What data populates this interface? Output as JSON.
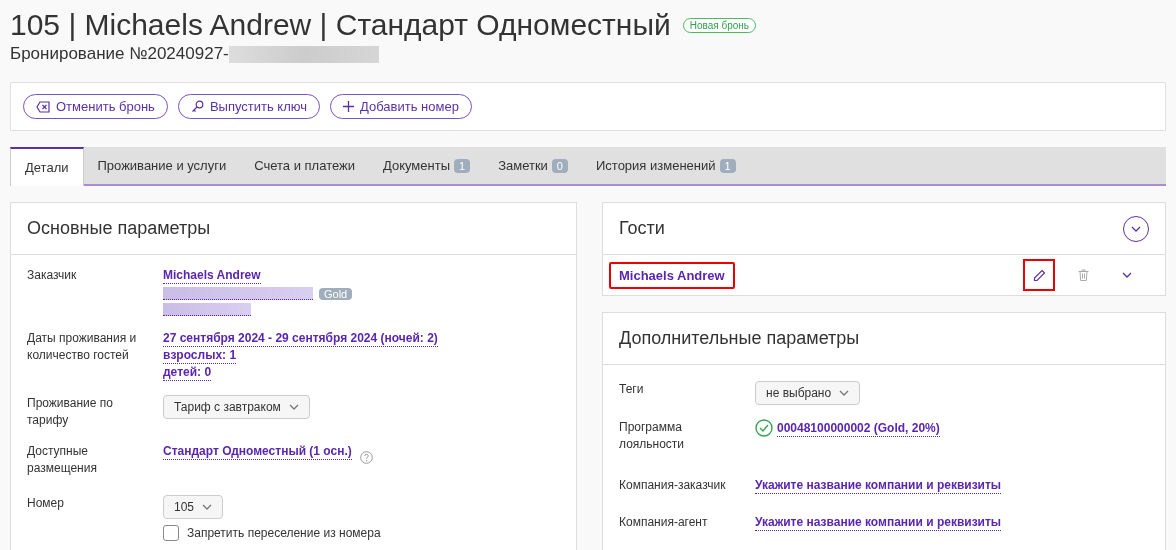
{
  "header": {
    "title": "105 | Michaels Andrew | Стандарт Одноместный",
    "status_badge": "Новая бронь",
    "subtitle": "Бронирование №20240927-",
    "subtitle_redacted": true
  },
  "actions": [
    {
      "label": "Отменить бронь",
      "kind": "cancel"
    },
    {
      "label": "Выпустить ключ",
      "kind": "key"
    },
    {
      "label": "Добавить номер",
      "kind": "add"
    }
  ],
  "tabs": [
    {
      "label": "Детали",
      "selected": true
    },
    {
      "label": "Проживание и услуги",
      "selected": false
    },
    {
      "label": "Счета и платежи",
      "selected": false
    },
    {
      "label": "Документы",
      "count": "1",
      "selected": false
    },
    {
      "label": "Заметки",
      "count": "0",
      "selected": false
    },
    {
      "label": "История изменений",
      "count": "1",
      "selected": false
    }
  ],
  "main_params": {
    "title": "Основные параметры",
    "rows": [
      {
        "kind": "customer",
        "label": "Заказчик",
        "name": "Michaels Andrew",
        "badge": "Gold",
        "redacted": true
      },
      {
        "kind": "links",
        "label": "Даты проживания и количество гостей",
        "links": [
          "27 сентября 2024 - 29 сентября 2024 (ночей: 2)",
          "взрослых: 1",
          "детей: 0"
        ]
      },
      {
        "kind": "select",
        "label": "Проживание по тарифу",
        "value": "Тариф с завтраком"
      },
      {
        "kind": "help_link",
        "label": "Доступные размещения",
        "value": "Стандарт Одноместный (1 осн.)"
      },
      {
        "kind": "select",
        "label": "Номер",
        "value": "105",
        "checkbox": {
          "label": "Запретить переселение из номера",
          "checked": false
        }
      }
    ]
  },
  "guests": {
    "title": "Гости",
    "items": [
      {
        "name": "Michaels Andrew",
        "highlighted": true,
        "edit_highlighted": true
      }
    ]
  },
  "extra_params": {
    "title": "Дополнительные параметры",
    "rows": [
      {
        "kind": "select",
        "label": "Теги",
        "value": "не выбрано"
      },
      {
        "kind": "loyalty",
        "label": "Программа лояльности",
        "value": "00048100000002 (Gold, 20%)",
        "verified": true
      },
      {
        "kind": "link",
        "label": "Компания-заказчик",
        "value": "Укажите название компании и реквизиты"
      },
      {
        "kind": "link",
        "label": "Компания-агент",
        "value": "Укажите название компании и реквизиты"
      }
    ]
  }
}
